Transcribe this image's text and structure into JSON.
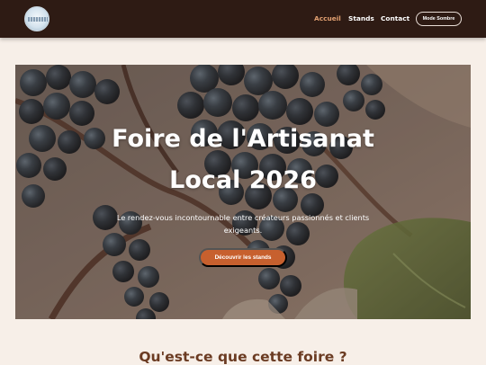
{
  "nav": {
    "logo_icon": "fair-logo-icon",
    "links": [
      "Accueil",
      "Stands",
      "Contact"
    ],
    "active_link": "Accueil",
    "dark_mode_label": "Mode Sombre"
  },
  "hero": {
    "title_line1": "Foire de l'Artisanat",
    "title_line2": "Local 2026",
    "subtitle_line1": "Le rendez-vous incontournable entre créateurs passionnés et clients",
    "subtitle_line2": "exigeants.",
    "cta_label": "Découvrir les stands",
    "background_image": "grapes-vineyard-photo"
  },
  "section": {
    "title": "Qu'est-ce que cette foire ?"
  },
  "colors": {
    "navbar": "#2e1b14",
    "accent": "#c7602e",
    "active_link": "#e2a071",
    "page_bg": "#f7efe8",
    "heading": "#6b3b22"
  }
}
